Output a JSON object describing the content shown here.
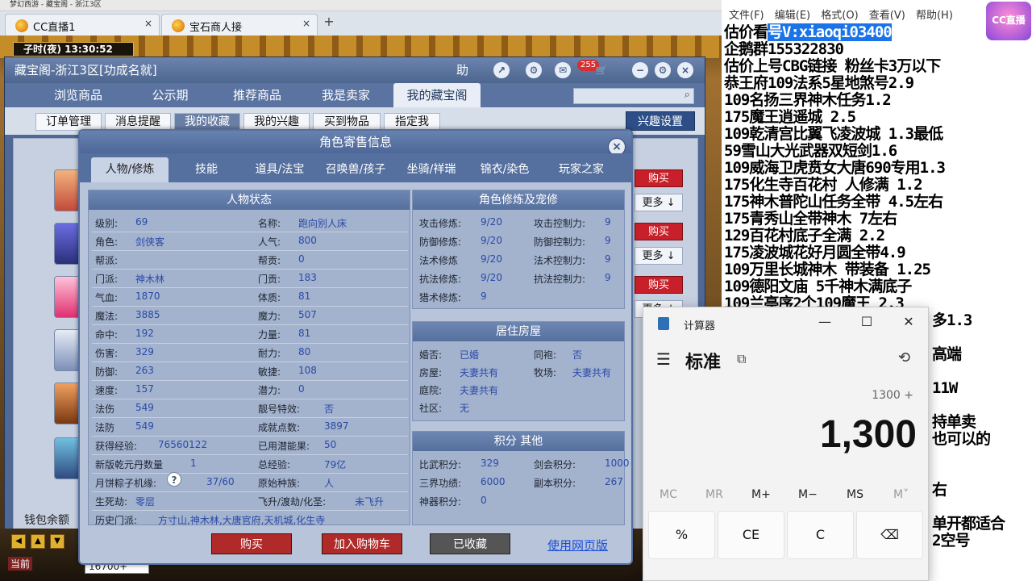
{
  "browser": {
    "strip_text": "梦幻西游 - 藏宝阁 - 浙江3区",
    "tabs": [
      {
        "label": "CC直播1"
      },
      {
        "label": "宝石商人接"
      }
    ],
    "close_glyph": "×",
    "new_tab_glyph": "+"
  },
  "game": {
    "clock": "子时(夜)  13:30:52",
    "hp_value": "16700+",
    "wallet_label": "钱包余额",
    "bottom_label": "当前"
  },
  "cbg": {
    "title": "藏宝阁-浙江3区[功成名就]",
    "help": "助",
    "badge": "255",
    "main_tabs": [
      "浏览商品",
      "公示期",
      "推荐商品",
      "我是卖家",
      "我的藏宝阁"
    ],
    "sub_tabs": [
      "订单管理",
      "消息提醒",
      "我的收藏",
      "我的兴趣",
      "买到物品",
      "指定我"
    ],
    "interest_btn": "兴趣设置",
    "buy_label": "购买",
    "more_label": "更多 ↓"
  },
  "modal": {
    "title": "角色寄售信息",
    "close": "×",
    "tabs": [
      "人物/修炼",
      "技能",
      "道具/法宝",
      "召唤兽/孩子",
      "坐骑/祥瑞",
      "锦衣/染色",
      "玩家之家"
    ],
    "status_title": "人物状态",
    "left_col": [
      {
        "k": "级别:",
        "v": "69"
      },
      {
        "k": "角色:",
        "v": "剑侠客"
      },
      {
        "k": "帮派:",
        "v": ""
      },
      {
        "k": "门派:",
        "v": "神木林"
      },
      {
        "k": "气血:",
        "v": "1870"
      },
      {
        "k": "魔法:",
        "v": "3885"
      },
      {
        "k": "命中:",
        "v": "192"
      },
      {
        "k": "伤害:",
        "v": "329"
      },
      {
        "k": "防御:",
        "v": "263"
      },
      {
        "k": "速度:",
        "v": "157"
      },
      {
        "k": "法伤",
        "v": "549"
      },
      {
        "k": "法防",
        "v": "549"
      },
      {
        "k": "获得经验:",
        "v": "76560122"
      },
      {
        "k": "新版乾元丹数量",
        "v": "1"
      },
      {
        "k": "月饼粽子机缘:",
        "v": "37/60"
      },
      {
        "k": "生死劫:",
        "v": "零层"
      },
      {
        "k": "历史门派:",
        "v": "方寸山,神木林,大唐官府,天机城,化生寺"
      }
    ],
    "right_col": [
      {
        "k": "名称:",
        "v": "跑向别人床"
      },
      {
        "k": "人气:",
        "v": "800"
      },
      {
        "k": "帮贡:",
        "v": "0"
      },
      {
        "k": "门贡:",
        "v": "183"
      },
      {
        "k": "体质:",
        "v": "81"
      },
      {
        "k": "魔力:",
        "v": "507"
      },
      {
        "k": "力量:",
        "v": "81"
      },
      {
        "k": "耐力:",
        "v": "80"
      },
      {
        "k": "敏捷:",
        "v": "108"
      },
      {
        "k": "潜力:",
        "v": "0"
      },
      {
        "k": "靓号特效:",
        "v": "否"
      },
      {
        "k": "成就点数:",
        "v": "3897"
      },
      {
        "k": "已用潜能果:",
        "v": "50"
      },
      {
        "k": "总经验:",
        "v": "79亿"
      },
      {
        "k": "原始种族:",
        "v": "人"
      },
      {
        "k": "飞升/渡劫/化圣:",
        "v": "未飞升"
      }
    ],
    "cultivation_title": "角色修炼及宠修",
    "cultivation": [
      {
        "k": "攻击修炼:",
        "v": "9/20",
        "k2": "攻击控制力:",
        "v2": "9"
      },
      {
        "k": "防御修炼:",
        "v": "9/20",
        "k2": "防御控制力:",
        "v2": "9"
      },
      {
        "k": "法术修炼",
        "v": "9/20",
        "k2": "法术控制力:",
        "v2": "9"
      },
      {
        "k": "抗法修炼:",
        "v": "9/20",
        "k2": "抗法控制力:",
        "v2": "9"
      },
      {
        "k": "猎术修炼:",
        "v": "9",
        "k2": "",
        "v2": ""
      }
    ],
    "house_title": "居住房屋",
    "house": [
      {
        "k": "婚否:",
        "v": "已婚",
        "k2": "同袍:",
        "v2": "否"
      },
      {
        "k": "房屋:",
        "v": "夫妻共有",
        "k2": "牧场:",
        "v2": "夫妻共有"
      },
      {
        "k": "庭院:",
        "v": "夫妻共有",
        "k2": "",
        "v2": ""
      },
      {
        "k": "社区:",
        "v": "无",
        "k2": "",
        "v2": ""
      }
    ],
    "score_title": "积分 其他",
    "score": [
      {
        "k": "比武积分:",
        "v": "329",
        "k2": "剑会积分:",
        "v2": "1000"
      },
      {
        "k": "三界功绩:",
        "v": "6000",
        "k2": "副本积分:",
        "v2": "267"
      },
      {
        "k": "神器积分:",
        "v": "0",
        "k2": "",
        "v2": ""
      }
    ],
    "qmark": "?",
    "buttons": {
      "buy": "购买",
      "add_cart": "加入购物车",
      "collected": "已收藏",
      "web": "使用网页版"
    }
  },
  "notepad": {
    "menu": [
      "文件(F)",
      "编辑(E)",
      "格式(O)",
      "查看(V)",
      "帮助(H)"
    ],
    "logo": "CC直播",
    "lines": [
      {
        "pre": "估价看",
        "hl": "号V:xiaoqi03400",
        "post": ""
      },
      {
        "pre": "企鹅群155322830",
        "hl": "",
        "post": ""
      },
      {
        "pre": "估价上号CBG链接  粉丝卡3万以下",
        "hl": "",
        "post": ""
      },
      {
        "pre": "恭王府109法系5星地煞号2.9",
        "hl": "",
        "post": ""
      },
      {
        "pre": "109名扬三界神木任务1.2",
        "hl": "",
        "post": ""
      },
      {
        "pre": "175魔王逍遥城 2.5",
        "hl": "",
        "post": ""
      },
      {
        "pre": "109乾清宫比翼飞凌波城 1.3最低",
        "hl": "",
        "post": ""
      },
      {
        "pre": "59雪山大光武器双短剑1.6",
        "hl": "",
        "post": ""
      },
      {
        "pre": "109威海卫虎贲女大唐690专用1.3",
        "hl": "",
        "post": ""
      },
      {
        "pre": "175化生寺百花村 人修满 1.2",
        "hl": "",
        "post": ""
      },
      {
        "pre": "175神木普陀山任务全带 4.5左右",
        "hl": "",
        "post": ""
      },
      {
        "pre": "175青秀山全带神木  7左右",
        "hl": "",
        "post": ""
      },
      {
        "pre": "129百花村底子全满 2.2",
        "hl": "",
        "post": ""
      },
      {
        "pre": "175凌波城花好月圆全带4.9",
        "hl": "",
        "post": ""
      },
      {
        "pre": "109万里长城神木 带装备  1.25",
        "hl": "",
        "post": ""
      },
      {
        "pre": "109德阳文庙 5千神木满底子",
        "hl": "",
        "post": ""
      },
      {
        "pre": "109兰亭序2个109魔王 2.3",
        "hl": "",
        "post": ""
      },
      {
        "pre": "",
        "hl": "",
        "post": "多1.3"
      },
      {
        "pre": "",
        "hl": "",
        "post": ""
      },
      {
        "pre": "",
        "hl": "",
        "post": "高端"
      },
      {
        "pre": "",
        "hl": "",
        "post": ""
      },
      {
        "pre": "",
        "hl": "",
        "post": "11W"
      },
      {
        "pre": "",
        "hl": "",
        "post": ""
      },
      {
        "pre": "",
        "hl": "",
        "post": "持单卖"
      },
      {
        "pre": "",
        "hl": "",
        "post": "也可以的"
      },
      {
        "pre": "",
        "hl": "",
        "post": ""
      },
      {
        "pre": "",
        "hl": "",
        "post": ""
      },
      {
        "pre": "",
        "hl": "",
        "post": "右"
      },
      {
        "pre": "",
        "hl": "",
        "post": ""
      },
      {
        "pre": "",
        "hl": "",
        "post": "单开都适合"
      },
      {
        "pre": "",
        "hl": "",
        "post": "2空号"
      }
    ]
  },
  "calculator": {
    "title": "计算器",
    "mode": "标准",
    "expression": "1300 +",
    "display": "1,300",
    "memory": [
      "MC",
      "MR",
      "M+",
      "M−",
      "MS",
      "M˅"
    ],
    "keys_row1": [
      "%",
      "CE",
      "C",
      "⌫"
    ],
    "win": {
      "min": "—",
      "max": "☐",
      "close": "✕"
    },
    "hamburger": "☰",
    "keep_on_top": "⧉",
    "history": "⟲"
  },
  "colors": {
    "cbg_blue": "#4f6894",
    "buy_red": "#c8202a",
    "link_blue": "#1a4ed8",
    "highlight": "#1a73e8"
  }
}
